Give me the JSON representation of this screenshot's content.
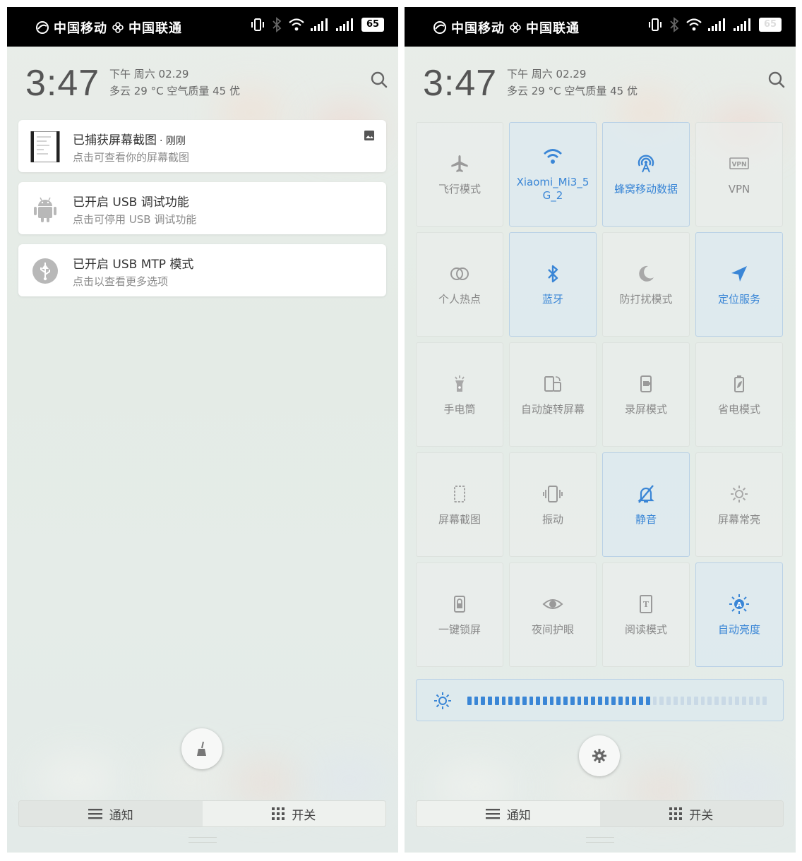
{
  "status_bar": {
    "carrier_1": "中国移动",
    "carrier_2": "中国联通",
    "battery_left": "65",
    "battery_right": "65"
  },
  "header": {
    "time": "3:47",
    "date": "下午 周六   02.29",
    "weather": "多云    29 °C    空气质量 45    优"
  },
  "notifications": [
    {
      "title": "已捕获屏幕截图",
      "time": "· 刚刚",
      "subtitle": "点击可查看你的屏幕截图",
      "icon": "screenshot-thumbnail-icon"
    },
    {
      "title": "已开启 USB 调试功能",
      "subtitle": "点击可停用 USB 调试功能",
      "icon": "android-icon"
    },
    {
      "title": "已开启 USB MTP 模式",
      "subtitle": "点击以查看更多选项",
      "icon": "usb-icon"
    }
  ],
  "toggles": [
    {
      "label": "飞行模式",
      "icon": "airplane-icon",
      "on": false
    },
    {
      "label": "Xiaomi_Mi3_5G_2",
      "icon": "wifi-icon",
      "on": true
    },
    {
      "label": "蜂窝移动数据",
      "icon": "cellular-data-icon",
      "on": true
    },
    {
      "label": "VPN",
      "icon": "vpn-icon",
      "on": false
    },
    {
      "label": "个人热点",
      "icon": "hotspot-icon",
      "on": false
    },
    {
      "label": "蓝牙",
      "icon": "bluetooth-icon",
      "on": true
    },
    {
      "label": "防打扰模式",
      "icon": "moon-icon",
      "on": false
    },
    {
      "label": "定位服务",
      "icon": "location-icon",
      "on": true
    },
    {
      "label": "手电筒",
      "icon": "flashlight-icon",
      "on": false
    },
    {
      "label": "自动旋转屏幕",
      "icon": "rotate-icon",
      "on": false
    },
    {
      "label": "录屏模式",
      "icon": "screen-record-icon",
      "on": false
    },
    {
      "label": "省电模式",
      "icon": "battery-saver-icon",
      "on": false
    },
    {
      "label": "屏幕截图",
      "icon": "screenshot-icon",
      "on": false
    },
    {
      "label": "振动",
      "icon": "vibrate-icon",
      "on": false
    },
    {
      "label": "静音",
      "icon": "mute-icon",
      "on": true
    },
    {
      "label": "屏幕常亮",
      "icon": "sun-icon",
      "on": false
    },
    {
      "label": "一键锁屏",
      "icon": "lock-icon",
      "on": false
    },
    {
      "label": "夜间护眼",
      "icon": "eye-icon",
      "on": false
    },
    {
      "label": "阅读模式",
      "icon": "reading-icon",
      "on": false
    },
    {
      "label": "自动亮度",
      "icon": "auto-brightness-icon",
      "on": true
    }
  ],
  "brightness": {
    "level": 0.62,
    "segments": 44
  },
  "tabs": {
    "notifications": "通知",
    "toggles": "开关"
  },
  "colors": {
    "accent": "#3a86d6",
    "status_bar": "#000000"
  }
}
